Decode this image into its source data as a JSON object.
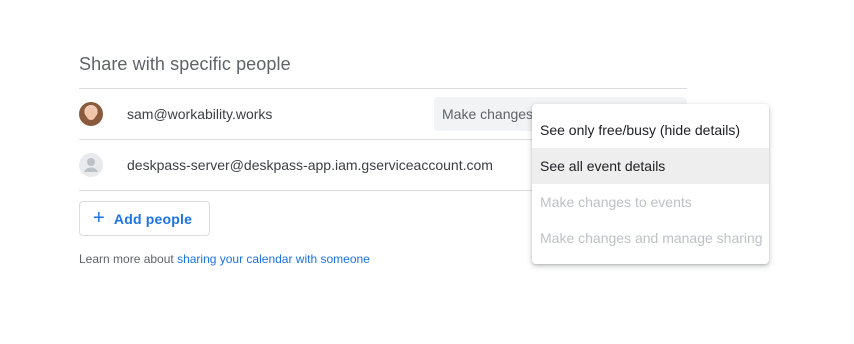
{
  "section": {
    "title": "Share with specific people"
  },
  "people": [
    {
      "email": "sam@workability.works",
      "permission": "Make changes",
      "avatar": "user-photo"
    },
    {
      "email": "deskpass-server@deskpass-app.iam.gserviceaccount.com",
      "avatar": "person-icon"
    }
  ],
  "add_button": {
    "icon": "plus-icon",
    "label": "Add people"
  },
  "learn_more": {
    "prefix": "Learn more about ",
    "link": "sharing your calendar with someone"
  },
  "permission_menu": {
    "options": [
      {
        "label": "See only free/busy (hide details)",
        "state": "enabled"
      },
      {
        "label": "See all event details",
        "state": "selected"
      },
      {
        "label": "Make changes to events",
        "state": "disabled"
      },
      {
        "label": "Make changes and manage sharing",
        "state": "disabled"
      }
    ]
  },
  "colors": {
    "accent": "#1a73e8",
    "divider": "#dadce0",
    "select_bg": "#f1f3f4",
    "disabled_text": "#bdc1c6"
  }
}
